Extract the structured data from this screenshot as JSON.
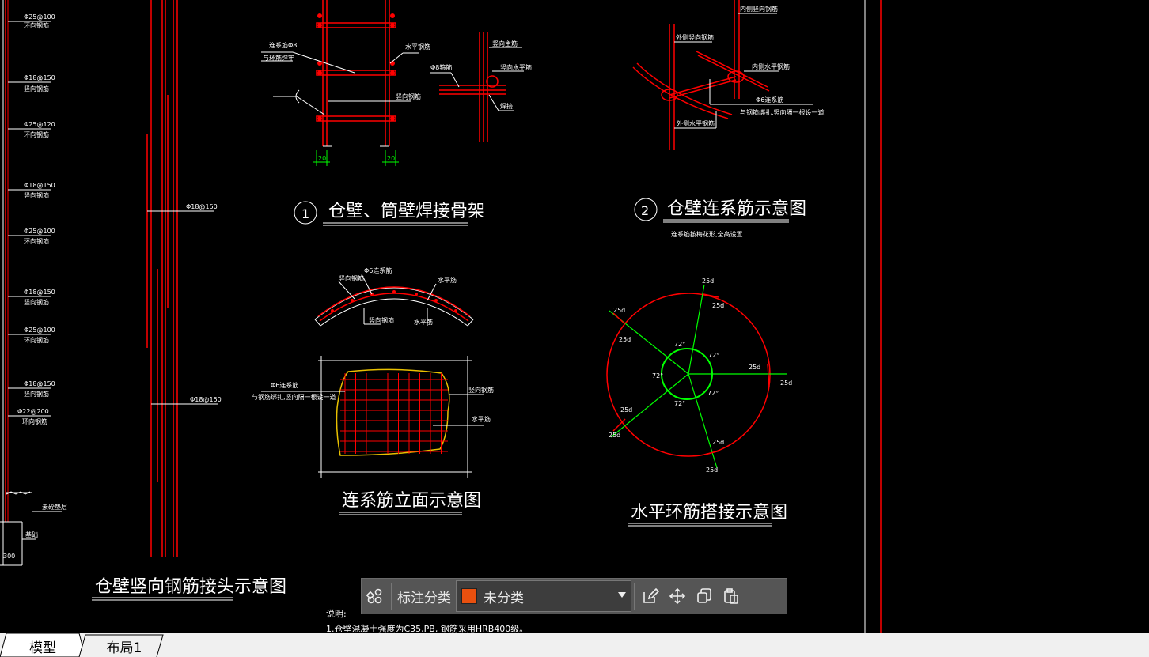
{
  "drawing": {
    "titles": {
      "t1_num": "1",
      "t1": "仓壁、筒壁焊接骨架",
      "t2_num": "2",
      "t2": "仓壁连系筋示意图",
      "t2_sub": "连系筋按梅花形,全高设置",
      "t3": "连系筋立面示意图",
      "t4": "水平环筋搭接示意图",
      "t5": "仓壁竖向钢筋接头示意图"
    },
    "left_notes": [
      {
        "a": "Φ25@100",
        "b": "环向钢筋"
      },
      {
        "a": "Φ18@150",
        "b": "竖向钢筋"
      },
      {
        "a": "Φ25@120",
        "b": "环向钢筋"
      },
      {
        "a": "Φ18@150",
        "b": "竖向钢筋"
      },
      {
        "a": "Φ25@100",
        "b": "环向钢筋"
      },
      {
        "a": "Φ18@150",
        "b": "竖向钢筋"
      },
      {
        "a": "Φ25@100",
        "b": "环向钢筋"
      },
      {
        "a": "Φ18@150",
        "b": "竖向钢筋"
      },
      {
        "a": "Φ22@200",
        "b": "环向钢筋"
      }
    ],
    "left_bottom": {
      "a": "素砼垫层",
      "b": "基础",
      "c": "300"
    },
    "vbar_notes": {
      "a": "Φ18@150",
      "b": "Φ18@150"
    },
    "fig1_labels": {
      "a": "连系筋Φ8",
      "b": "与环筋焊牢",
      "c": "水平钢筋",
      "d": "竖向钢筋",
      "dim": "20"
    },
    "fig_detail_labels": {
      "a": "竖向主筋",
      "b": "Φ8箍筋",
      "c": "竖向水平筋",
      "d": "焊接"
    },
    "fig2_labels": {
      "a": "内侧竖向钢筋",
      "b": "外侧竖向钢筋",
      "c": "内侧水平钢筋",
      "d": "Φ6连系筋",
      "e": "与钢筋绑扎,竖向隔一根设一道",
      "f": "外侧水平钢筋"
    },
    "fig3_labels": {
      "a": "竖向钢筋",
      "b": "Φ6连系筋",
      "c": "水平筋",
      "d": "竖向钢筋",
      "e": "水平筋"
    },
    "fig4_labels": {
      "a": "Φ6连系筋",
      "b": "与钢筋绑扎,竖向隔一根设一道",
      "c": "竖向钢筋",
      "d": "水平筋"
    },
    "ring_labels": {
      "lap": "25d",
      "angle": "72°"
    },
    "notes_heading": "说明:",
    "notes_line1": "1.仓壁混凝土强度为C35,PB, 钢筋采用HRB400级。"
  },
  "toolbar": {
    "label": "标注分类",
    "select_value": "未分类",
    "swatch_color": "#e8500f",
    "icons": [
      "grid-icon",
      "edit-icon",
      "move-icon",
      "copy-icon",
      "paste-icon"
    ]
  },
  "tabs": {
    "model": "模型",
    "layout1": "布局1"
  },
  "colors": {
    "rebar": "#ff0000",
    "dimension": "#00ff00",
    "outline": "#e8c000",
    "text": "#ffffff",
    "background": "#000000"
  }
}
